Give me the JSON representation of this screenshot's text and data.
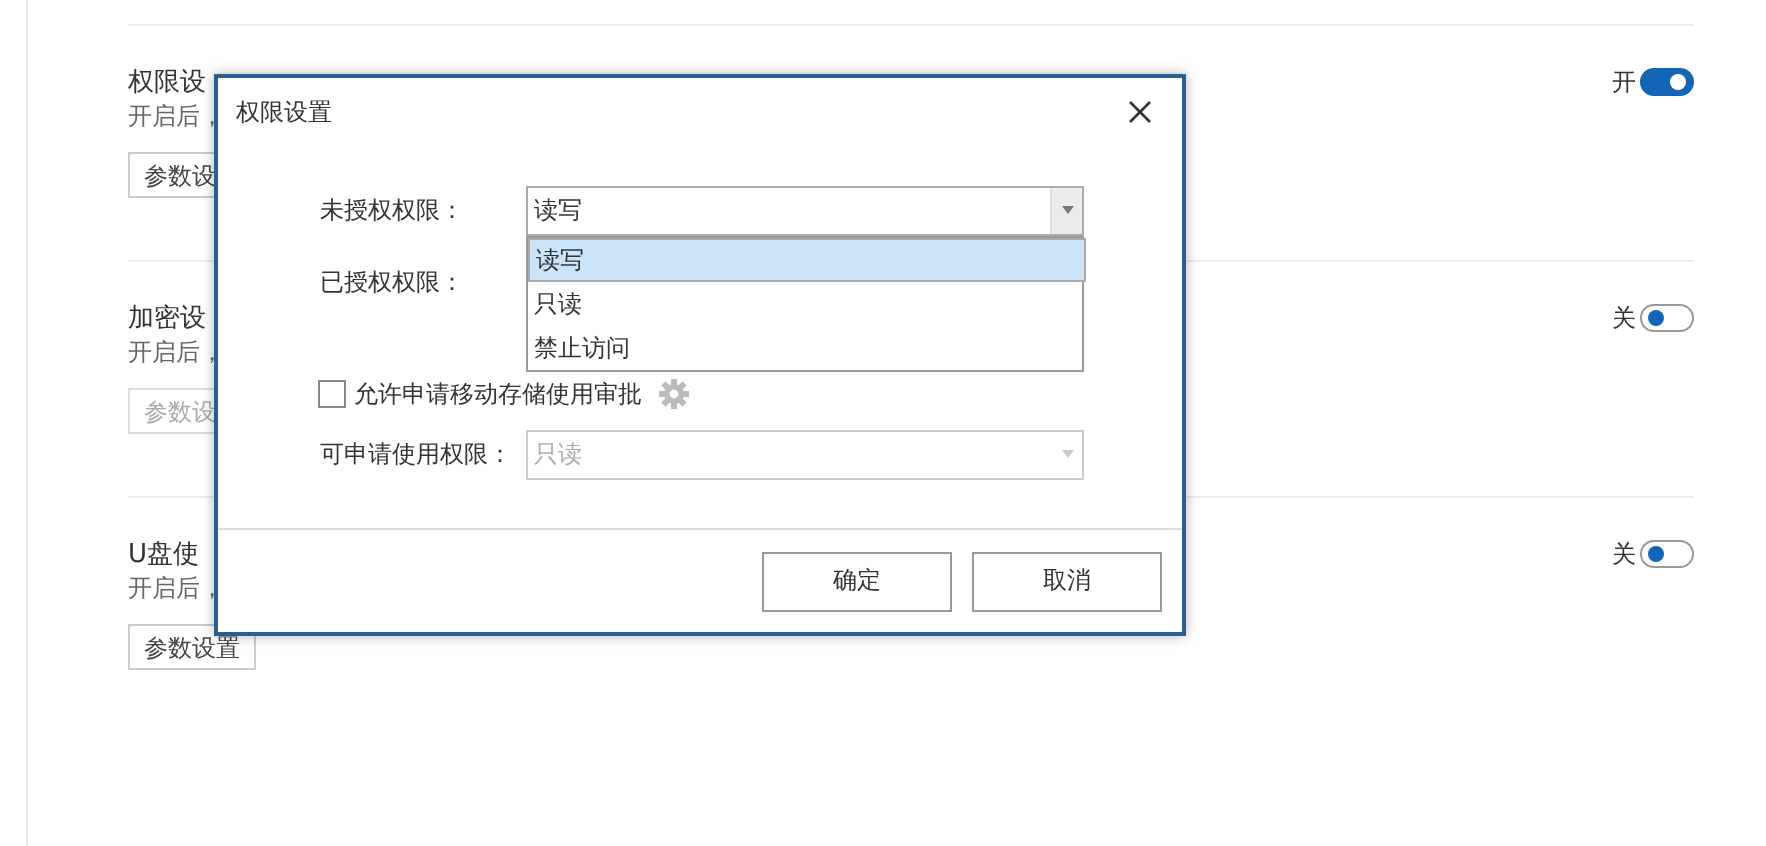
{
  "sections": [
    {
      "title": "权限设",
      "description": "开启后，",
      "button": {
        "label": "参数设",
        "disabled": false
      },
      "toggle": {
        "label": "开",
        "on": true
      }
    },
    {
      "title": "加密设",
      "description": "开启后，",
      "button": {
        "label": "参数设",
        "disabled": true
      },
      "toggle": {
        "label": "关",
        "on": false
      }
    },
    {
      "title": "U盘使",
      "description": "开启后，",
      "button": {
        "label": "参数设置",
        "disabled": false
      },
      "toggle": {
        "label": "关",
        "on": false
      }
    }
  ],
  "dialog": {
    "title": "权限设置",
    "fields": [
      {
        "kind": "select",
        "label": "未授权权限：",
        "value": "读写",
        "disabled": false,
        "expanded": true
      },
      {
        "kind": "select",
        "label": "已授权权限："
      },
      {
        "kind": "checkbox",
        "label": "允许申请移动存储使用审批",
        "checked": false
      },
      {
        "kind": "select",
        "label": "可申请使用权限：",
        "value": "只读",
        "disabled": true,
        "expanded": false
      }
    ],
    "options": [
      {
        "label": "读写",
        "selected": true
      },
      {
        "label": "只读",
        "selected": false
      },
      {
        "label": "禁止访问",
        "selected": false
      }
    ],
    "buttons": [
      "确定",
      "取消"
    ]
  }
}
